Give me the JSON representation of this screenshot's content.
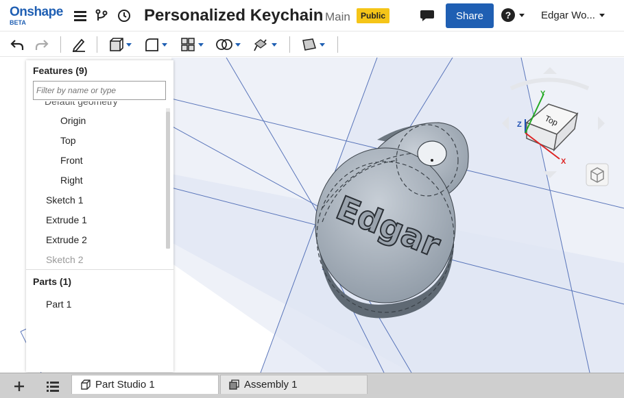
{
  "header": {
    "logo": "Onshape",
    "logo_badge": "BETA",
    "doc_title": "Personalized Keychain",
    "branch": "Main",
    "visibility_badge": "Public",
    "share_label": "Share",
    "user_name": "Edgar Wo..."
  },
  "toolbar": {
    "buttons": [
      "undo-icon",
      "redo-icon",
      "sketch-icon",
      "extrude-icon",
      "fillet-icon",
      "pattern-icon",
      "boolean-icon",
      "transform-icon",
      "plane-icon"
    ]
  },
  "feature_panel": {
    "title": "Features (9)",
    "filter_placeholder": "Filter by name or type",
    "items": [
      {
        "label": "Default geometry",
        "indent": 1
      },
      {
        "label": "Origin",
        "indent": 2
      },
      {
        "label": "Top",
        "indent": 2
      },
      {
        "label": "Front",
        "indent": 2
      },
      {
        "label": "Right",
        "indent": 2
      },
      {
        "label": "Sketch 1",
        "indent": 1
      },
      {
        "label": "Extrude 1",
        "indent": 1
      },
      {
        "label": "Extrude 2",
        "indent": 1
      },
      {
        "label": "Sketch 2",
        "indent": 1,
        "dim": true
      }
    ],
    "parts_title": "Parts (1)",
    "parts": [
      "Part 1"
    ]
  },
  "viewport": {
    "embossed_text": "Edgar",
    "view_cube_label": "Top",
    "axis_labels": {
      "x": "X",
      "y": "Y",
      "z": "Z"
    }
  },
  "bottom_tabs": {
    "tabs": [
      "Part Studio 1",
      "Assembly 1"
    ],
    "active": "Part Studio 1"
  },
  "colors": {
    "brand": "#1f5fb3",
    "public_badge": "#f5c518",
    "grid_line": "#3355aa",
    "keychain_body": "#a4aeb9"
  }
}
